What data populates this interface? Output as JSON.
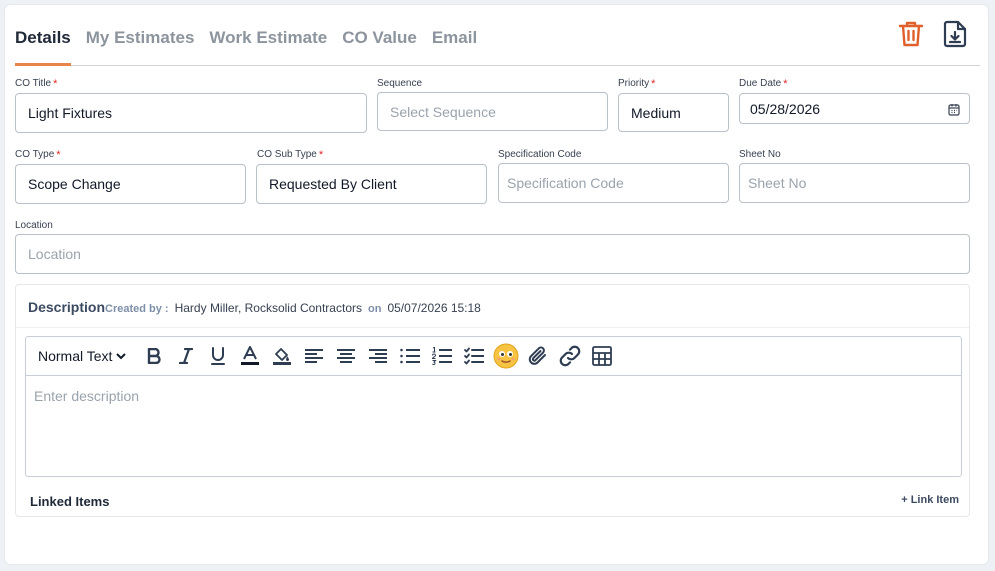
{
  "tabs": [
    {
      "label": "Details",
      "active": true
    },
    {
      "label": "My Estimates",
      "active": false
    },
    {
      "label": "Work Estimate",
      "active": false
    },
    {
      "label": "CO Value",
      "active": false
    },
    {
      "label": "Email",
      "active": false
    }
  ],
  "fields": {
    "co_title": {
      "label": "CO Title",
      "value": "Light Fixtures"
    },
    "sequence": {
      "label": "Sequence",
      "placeholder": "Select Sequence"
    },
    "priority": {
      "label": "Priority",
      "value": "Medium"
    },
    "due_date": {
      "label": "Due Date",
      "value": "05/28/2026"
    },
    "co_type": {
      "label": "CO Type",
      "value": "Scope Change"
    },
    "co_sub_type": {
      "label": "CO Sub Type",
      "value": "Requested By Client"
    },
    "spec_code": {
      "label": "Specification Code",
      "placeholder": "Specification Code"
    },
    "sheet_no": {
      "label": "Sheet No",
      "placeholder": "Sheet No"
    },
    "location": {
      "label": "Location",
      "placeholder": "Location"
    }
  },
  "required_mark": "*",
  "description": {
    "title": "Description",
    "created_by_label": "Created by :",
    "created_by": "Hardy Miller, Rocksolid Contractors",
    "on_label": "on",
    "created_at": "05/07/2026 15:18",
    "toolbar_text_style": "Normal Text",
    "placeholder": "Enter description"
  },
  "linked_items": {
    "title": "Linked Items",
    "link_label": "+ Link Item"
  },
  "colors": {
    "accent": "#e8834a",
    "delete_icon": "#e0612b",
    "icon_dark": "#2f3d52"
  }
}
